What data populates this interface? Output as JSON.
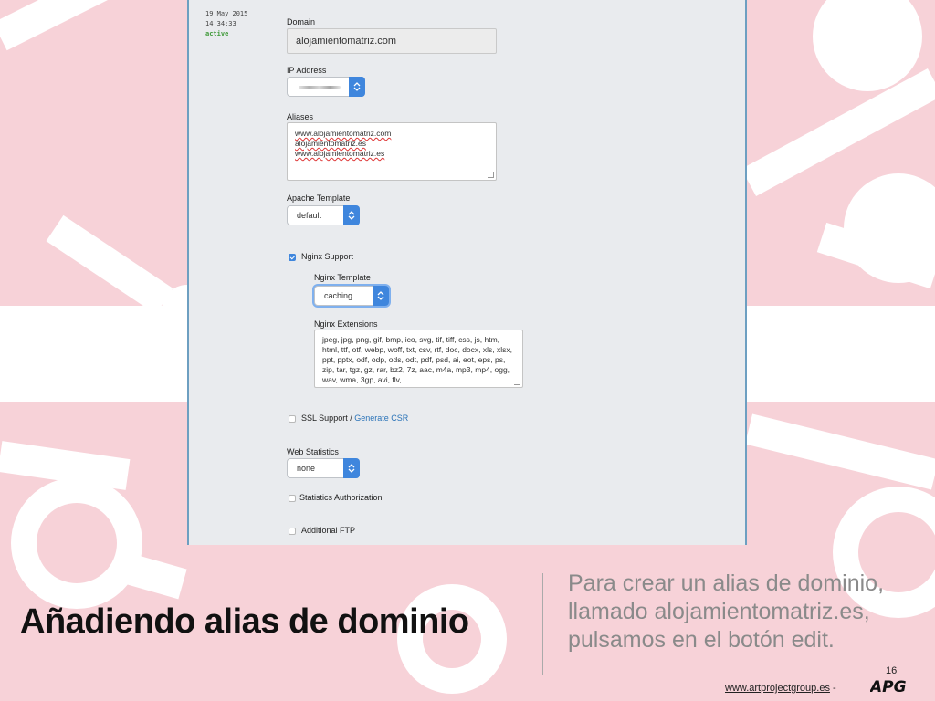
{
  "record": {
    "date": "19 May 2015",
    "time": "14:34:33",
    "status": "active"
  },
  "form": {
    "domain_label": "Domain",
    "domain_value": "alojamientomatriz.com",
    "ip_label": "IP Address",
    "aliases_label": "Aliases",
    "aliases": [
      "www.alojamientomatriz.com",
      "alojamientomatriz.es",
      "www.alojamientomatriz.es"
    ],
    "apache_label": "Apache Template",
    "apache_value": "default",
    "nginx_support_label": "Nginx Support",
    "nginx_support_checked": true,
    "nginx_template_label": "Nginx Template",
    "nginx_template_value": "caching",
    "nginx_ext_label": "Nginx Extensions",
    "nginx_ext_value": "jpeg, jpg, png, gif, bmp, ico, svg, tif, tiff, css, js, htm, html, ttf, otf, webp, woff, txt, csv, rtf, doc, docx, xls, xlsx, ppt, pptx, odf, odp, ods, odt, pdf, psd, ai, eot, eps, ps, zip, tar, tgz, gz, rar, bz2, 7z, aac, m4a, mp3, mp4, ogg, wav, wma, 3gp, avi, flv,",
    "ssl_label": "SSL Support /",
    "ssl_link": "Generate CSR",
    "web_stats_label": "Web Statistics",
    "web_stats_value": "none",
    "stats_auth_label": "Statistics Authorization",
    "additional_ftp_label": "Additional FTP"
  },
  "slide": {
    "title": "Añadiendo alias de dominio",
    "description": "Para crear un alias de dominio, llamado alojamientomatriz.es, pulsamos en el botón edit.",
    "page_number": "16",
    "footer_url": "www.artprojectgroup.es",
    "footer_sep": " -",
    "logo_text": "APG"
  },
  "colors": {
    "accent": "#3f86dd",
    "background": "#f7d2d8",
    "shapes": "#ffffff",
    "link": "#2a73b8"
  }
}
